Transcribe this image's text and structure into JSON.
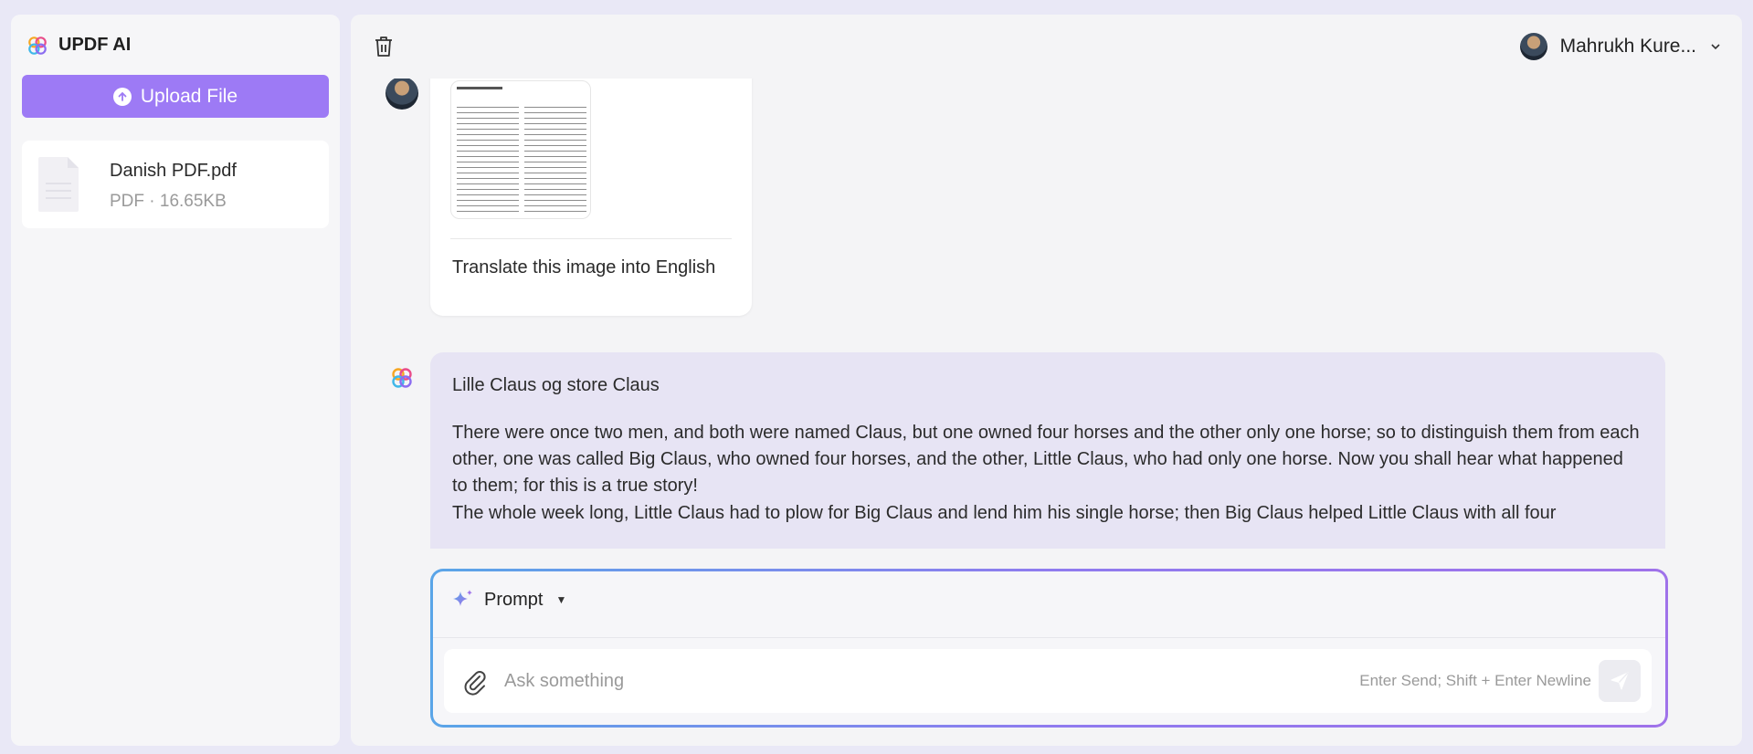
{
  "app": {
    "name": "UPDF AI"
  },
  "sidebar": {
    "upload_label": "Upload File",
    "files": [
      {
        "name": "Danish PDF.pdf",
        "meta": "PDF · 16.65KB"
      }
    ]
  },
  "header": {
    "user_name": "Mahrukh Kure...",
    "icons": [
      "trash-icon",
      "chevron-down-icon"
    ]
  },
  "chat": {
    "user_message": {
      "attachment": "document-image-thumbnail",
      "text": "Translate this image into English"
    },
    "ai_message": {
      "paragraphs": [
        "Lille Claus og store Claus",
        "There were once two men, and both were named Claus, but one owned four horses and the other only one horse; so to distinguish them from each other, one was called Big Claus, who owned four horses, and the other, Little Claus, who had only one horse. Now you shall hear what happened to them; for this is a true story!",
        "The whole week long, Little Claus had to plow for Big Claus and lend him his single horse; then Big Claus helped Little Claus with all four"
      ]
    }
  },
  "composer": {
    "mode_label": "Prompt",
    "placeholder": "Ask something",
    "hint": "Enter Send; Shift + Enter Newline"
  },
  "colors": {
    "accent": "#9d7af5",
    "ai_bubble": "#e7e4f4",
    "border_gradient": [
      "#5aa5e8",
      "#9f72ea"
    ]
  }
}
